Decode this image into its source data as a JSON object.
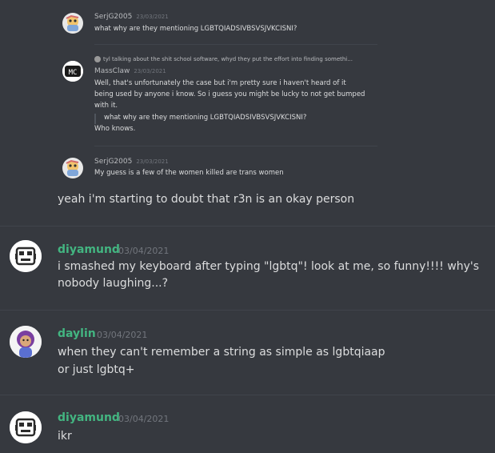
{
  "embed": {
    "msg1": {
      "author": "SerjG2005",
      "time": "23/03/2021",
      "text": "what why are they mentioning LGBTQIADSIVBSVSJVKCISNI?"
    },
    "msg2": {
      "reply_preview": "tyl talking about the shit school software, whyd they put the effort into finding somethi...",
      "author": "MassClaw",
      "time": "23/03/2021",
      "lines": [
        "Well, that's unfortunately the case but i'm pretty sure i haven't heard of it",
        "being used by anyone i know. So i guess you might be lucky to not get bumped",
        "with it."
      ],
      "quote": "what why are they mentioning LGBTQIADSIVBSVSJVKCISNI?",
      "after_quote": "Who knows."
    },
    "msg3": {
      "author": "SerjG2005",
      "time": "23/03/2021",
      "text": "My guess is a few of the women killed are trans women"
    },
    "avatar_mc_text": "MC"
  },
  "messages": [
    {
      "continuation": "yeah i'm starting to doubt that r3n is an okay person"
    },
    {
      "author": "diyamund",
      "time": "03/04/2021",
      "lines": [
        "i smashed my keyboard after typing \"lgbtq\"! look at me, so funny!!!! why's",
        "nobody laughing...?"
      ]
    },
    {
      "author": "daylin",
      "time": "03/04/2021",
      "lines": [
        "when they can't remember a string as simple as lgbtqiaap",
        "or just lgbtq+"
      ]
    },
    {
      "author": "diyamund",
      "time": "03/04/2021",
      "lines": [
        "ikr"
      ]
    }
  ],
  "colors": {
    "background": "#36393f",
    "username_green": "#43b581",
    "text": "#dcddde",
    "muted": "#72767d"
  }
}
